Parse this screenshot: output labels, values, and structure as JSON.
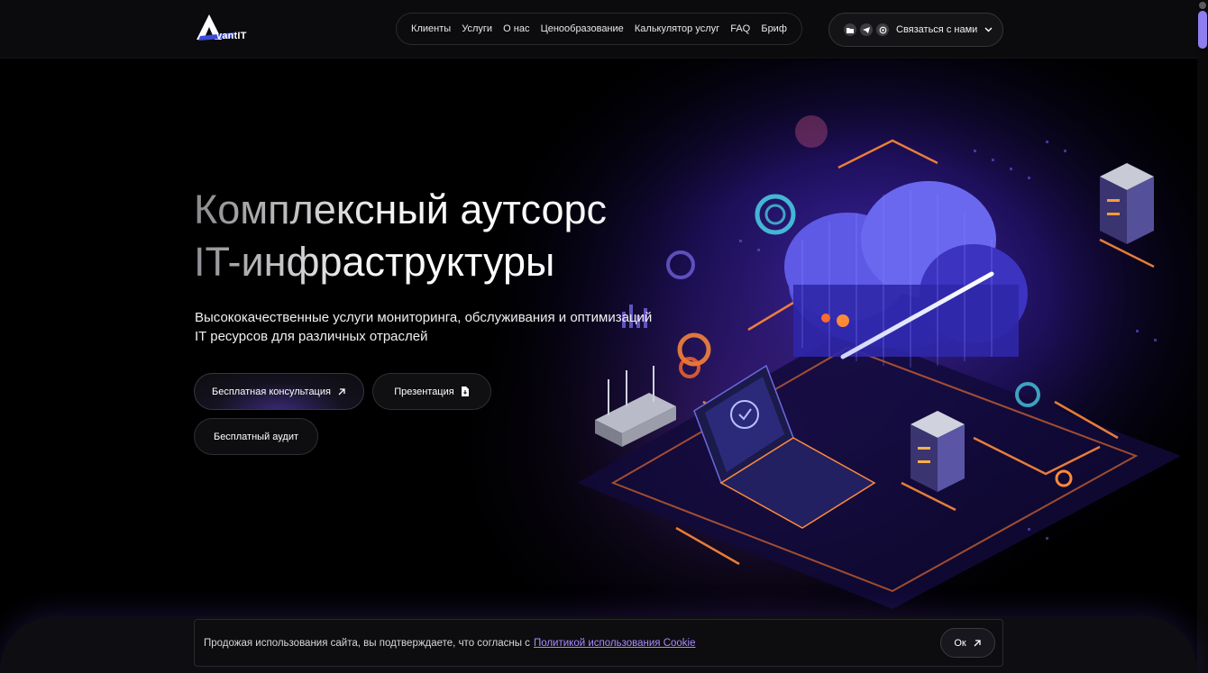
{
  "header": {
    "logo_text": "vantIT",
    "nav": [
      "Клиенты",
      "Услуги",
      "О нас",
      "Ценообразование",
      "Калькулятор услуг",
      "FAQ",
      "Бриф"
    ],
    "contact_label": "Связаться с нами",
    "contact_icons": [
      "folder-icon",
      "telegram-icon",
      "whatsapp-icon"
    ]
  },
  "hero": {
    "title_line1": "Комплексный аутсорс",
    "title_line2": "IT-инфраструктуры",
    "subtitle_line1": "Высококачественные услуги мониторинга, обслуживания и оптимизаций",
    "subtitle_line2": "IT ресурсов для различных отраслей",
    "buttons": {
      "consult": "Бесплатная консультация",
      "presentation": "Презентация",
      "audit": "Бесплатный аудит"
    }
  },
  "cookie": {
    "text": "Продожая использования сайта, вы подтверждаете, что согласны с",
    "link": "Политикой использования Cookie",
    "ok": "Ок"
  },
  "colors": {
    "accent": "#8d7ff0",
    "link": "#a98bff",
    "background": "#000000"
  }
}
